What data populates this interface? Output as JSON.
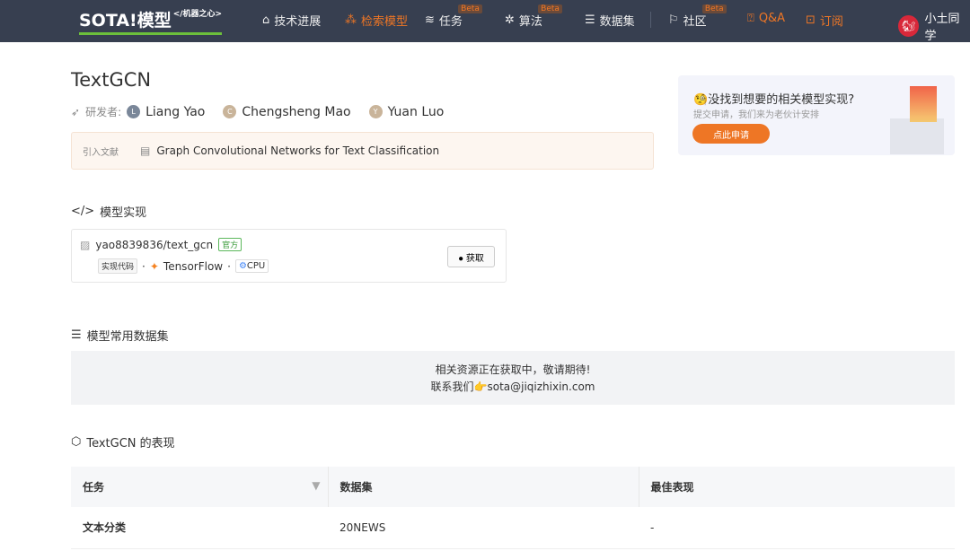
{
  "nav": {
    "logo": "SOTA!模型",
    "logo_sub": "</机器之心>",
    "items": [
      {
        "label": "技术进展",
        "icon": "compass-icon"
      },
      {
        "label": "检索模型",
        "icon": "hexagons-icon",
        "active": true
      },
      {
        "label": "任务",
        "icon": "layers-icon",
        "badge": "Beta"
      },
      {
        "label": "算法",
        "icon": "atom-icon",
        "badge": "Beta"
      },
      {
        "label": "数据集",
        "icon": "database-icon"
      },
      {
        "label": "社区",
        "icon": "flag-icon",
        "badge": "Beta"
      },
      {
        "label": "Q&A",
        "icon": "question-icon"
      },
      {
        "label": "订阅",
        "icon": "bookmark-icon"
      }
    ],
    "user": "小土同学"
  },
  "model": {
    "title": "TextGCN",
    "authors_label": "研发者:",
    "authors": [
      {
        "name": "Liang Yao",
        "initial": "L",
        "color": "#7a8799"
      },
      {
        "name": "Chengsheng Mao",
        "initial": "C",
        "color": "#c9b49a"
      },
      {
        "name": "Yuan Luo",
        "initial": "Y",
        "color": "#c9b49a"
      }
    ],
    "cite_label": "引入文献",
    "cite": "Graph Convolutional Networks for Text Classification"
  },
  "banner": {
    "title": "没找到想要的相关模型实现?",
    "subtitle": "提交申请，我们来为老伙计安排",
    "button": "点此申请"
  },
  "impl": {
    "heading": "模型实现",
    "repo": "yao8839836/text_gcn",
    "official": "官方",
    "tag": "实现代码",
    "framework": "TensorFlow",
    "device": "CPU",
    "get": "获取"
  },
  "datasets": {
    "heading": "模型常用数据集",
    "line1": "相关资源正在获取中，敬请期待!",
    "line2_prefix": "联系我们",
    "email": "sota@jiqizhixin.com"
  },
  "perf": {
    "heading": "TextGCN 的表现",
    "columns": [
      "任务",
      "数据集",
      "最佳表现"
    ],
    "rows": [
      [
        "文本分类",
        "20NEWS",
        "-"
      ]
    ]
  }
}
